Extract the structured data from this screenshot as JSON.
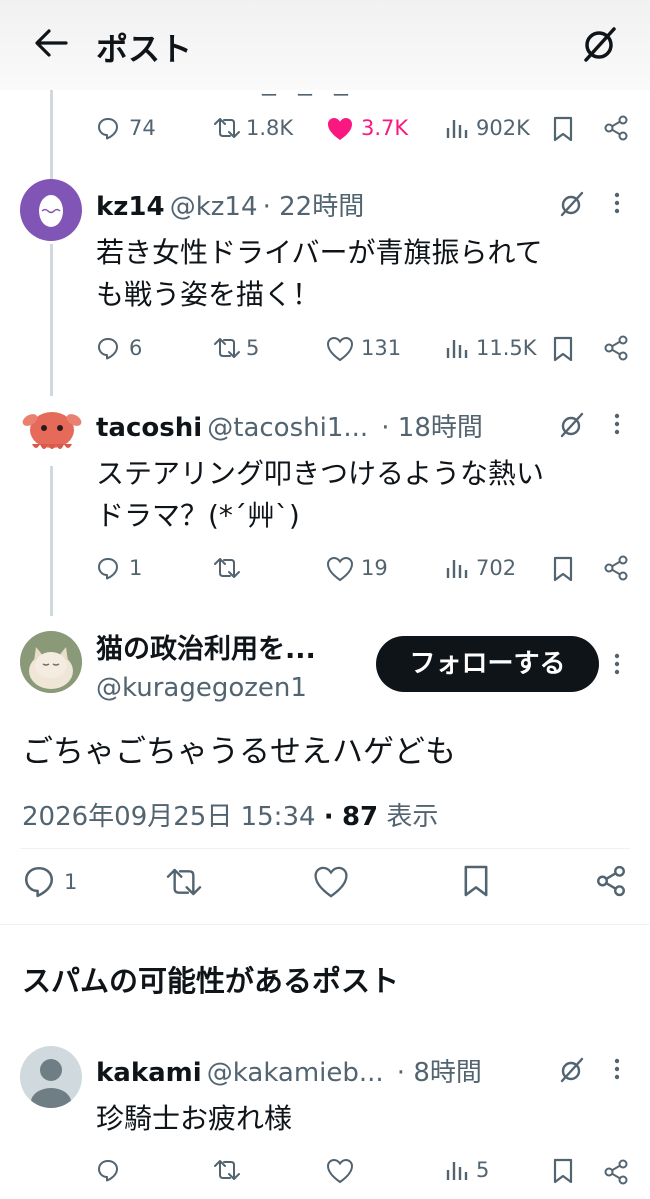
{
  "header": {
    "title": "ポスト"
  },
  "top_post": {
    "replies": "74",
    "reposts": "1.8K",
    "likes": "3.7K",
    "views": "902K"
  },
  "replies": [
    {
      "name": "kz14",
      "handle": "@kz14",
      "time": "· 22時間",
      "text": "若き女性ドライバーが青旗振られて\nも戦う姿を描く！",
      "stats": {
        "replies": "6",
        "reposts": "5",
        "likes": "131",
        "views": "11.5K"
      }
    },
    {
      "name": "tacoshi",
      "handle": "@tacoshi1...",
      "time": "· 18時間",
      "text": "ステアリング叩きつけるような熱い\nドラマ？(*´艸`)",
      "stats": {
        "replies": "1",
        "reposts": "",
        "likes": "19",
        "views": "702"
      }
    }
  ],
  "main_post": {
    "name": "猫の政治利用を...",
    "handle": "@kuragegozen1",
    "follow_label": "フォローする",
    "text": "ごちゃごちゃうるせえハゲども",
    "datetime": "2026年09月25日 15:34",
    "separator": "·",
    "views_count": "87",
    "views_label": "表示",
    "replies": "1"
  },
  "spam_section": {
    "title": "スパムの可能性があるポスト",
    "post": {
      "name": "kakami",
      "handle": "@kakamieb...",
      "time": "· 8時間",
      "text": "珍騎士お疲れ様",
      "stats": {
        "views": "5"
      }
    }
  },
  "colors": {
    "like_active": "#f91880",
    "gray": "#536471",
    "line": "#cfd9de"
  }
}
